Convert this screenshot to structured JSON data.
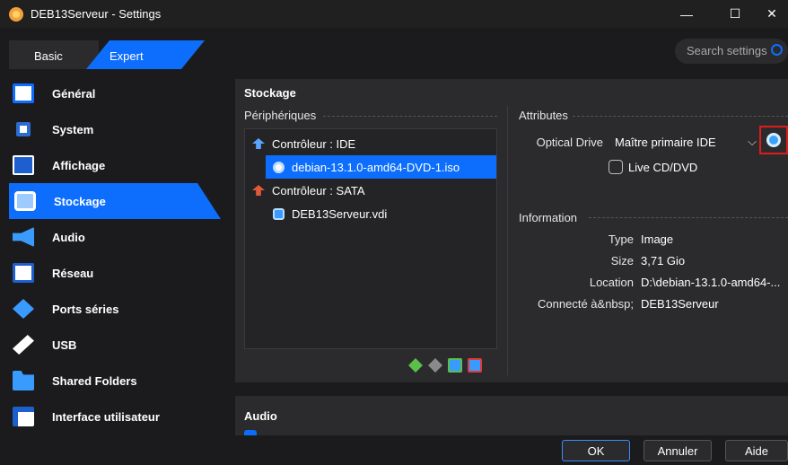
{
  "window": {
    "title": "DEB13Serveur - Settings",
    "minimize": "—",
    "maximize": "☐",
    "close": "✕"
  },
  "mode_tabs": {
    "basic": "Basic",
    "expert": "Expert"
  },
  "search": {
    "placeholder": "Search settings"
  },
  "nav": [
    {
      "label": "Général",
      "icon": "monitor-icon"
    },
    {
      "label": "System",
      "icon": "chip-icon"
    },
    {
      "label": "Affichage",
      "icon": "display-icon"
    },
    {
      "label": "Stockage",
      "icon": "storage-icon",
      "selected": true
    },
    {
      "label": "Audio",
      "icon": "speaker-icon"
    },
    {
      "label": "Réseau",
      "icon": "network-icon"
    },
    {
      "label": "Ports séries",
      "icon": "serial-icon"
    },
    {
      "label": "USB",
      "icon": "usb-icon"
    },
    {
      "label": "Shared Folders",
      "icon": "folder-icon"
    },
    {
      "label": "Interface utilisateur",
      "icon": "ui-icon"
    }
  ],
  "storage": {
    "title": "Stockage",
    "devices_label": "Périphériques",
    "tree": [
      {
        "label": "Contrôleur : IDE",
        "type": "controller"
      },
      {
        "label": "debian-13.1.0-amd64-DVD-1.iso",
        "type": "optical",
        "selected": true
      },
      {
        "label": "Contrôleur : SATA",
        "type": "controller"
      },
      {
        "label": "DEB13Serveur.vdi",
        "type": "disk"
      }
    ],
    "attributes_label": "Attributes",
    "optical_drive_label": "Optical Drive",
    "optical_drive_value": "Maître primaire IDE",
    "live_cd_label": "Live CD/DVD",
    "information_label": "Information",
    "info": {
      "type_label": "Type",
      "type_value": "Image",
      "size_label": "Size",
      "size_value": "3,71 Gio",
      "location_label": "Location",
      "location_value": "D:\\debian-13.1.0-amd64-...",
      "connected_label": "Connecté à&nbsp;",
      "connected_value": "DEB13Serveur"
    }
  },
  "audio_section": {
    "title": "Audio"
  },
  "footer": {
    "ok": "OK",
    "cancel": "Annuler",
    "help": "Aide"
  }
}
